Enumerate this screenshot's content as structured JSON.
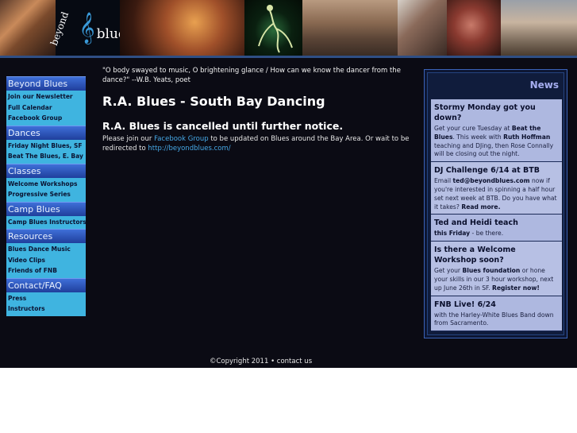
{
  "header": {
    "logo_line1": "beyond",
    "logo_line2": "blues",
    "photos": [
      "couple-photo",
      "logo",
      "guitarist-photo",
      "dancer-silhouette-photo",
      "dance-hall-photo",
      "swing-couple-photo",
      "embrace-photo",
      "group-photo"
    ],
    "colors": {
      "banner_rule": "#2f4f85",
      "clef": "#3a9ad8"
    }
  },
  "nav": [
    {
      "title": "Beyond Blues",
      "items": [
        "Join our Newsletter",
        "Full Calendar",
        "Facebook Group"
      ]
    },
    {
      "title": "Dances",
      "items": [
        "Friday Night Blues, SF",
        "Beat The Blues, E. Bay"
      ]
    },
    {
      "title": "Classes",
      "items": [
        "Welcome Workshops",
        "Progressive Series"
      ]
    },
    {
      "title": "Camp Blues",
      "items": [
        "Camp Blues Instructors"
      ]
    },
    {
      "title": "Resources",
      "items": [
        "Blues Dance Music",
        "Video Clips",
        "Friends of FNB"
      ]
    },
    {
      "title": "Contact/FAQ",
      "items": [
        "Press",
        "Instructors"
      ]
    }
  ],
  "main": {
    "quote": "\"O body swayed to music, O brightening glance / How can we know the dancer from the dance?\" --W.B. Yeats, poet",
    "title": "R.A. Blues - South Bay Dancing",
    "notice": "R.A. Blues is cancelled until further notice.",
    "message_before": "Please join our ",
    "facebook_link": "Facebook Group",
    "message_middle": " to be updated on Blues around the Bay Area. Or wait to be redirected to ",
    "redirect_link": "http://beyondblues.com/"
  },
  "news": {
    "title": "News",
    "items": [
      {
        "heading": "Stormy Monday got you down?",
        "parts": [
          {
            "t": "Get your cure Tuesday at ",
            "b": false
          },
          {
            "t": "Beat the Blues",
            "b": true
          },
          {
            "t": ". This week with ",
            "b": false
          },
          {
            "t": "Ruth Hoffman",
            "b": true
          },
          {
            "t": " teaching and DJing, then Rose Connally will be closing out the night.",
            "b": false
          }
        ]
      },
      {
        "heading": "DJ Challenge 6/14 at BTB",
        "parts": [
          {
            "t": "Email ",
            "b": false
          },
          {
            "t": "ted@beyondblues.com",
            "b": true
          },
          {
            "t": " now if you're interested in spinning a half hour set next week at BTB. Do you have what it takes? ",
            "b": false
          },
          {
            "t": "Read more.",
            "b": true
          }
        ]
      },
      {
        "heading": "Ted and Heidi teach",
        "parts": [
          {
            "t": "this Friday",
            "b": true
          },
          {
            "t": " - be there.",
            "b": false
          }
        ]
      },
      {
        "heading": "Is there a Welcome Workshop soon?",
        "parts": [
          {
            "t": "Get your ",
            "b": false
          },
          {
            "t": "Blues foundation",
            "b": true
          },
          {
            "t": " or hone your skills in our 3 hour workshop, next up June 26th in SF. ",
            "b": false
          },
          {
            "t": "Register now!",
            "b": true
          }
        ]
      },
      {
        "heading": "FNB Live! 6/24",
        "parts": [
          {
            "t": "with the Harley-White Blues Band down from Sacramento.",
            "b": false
          }
        ]
      }
    ]
  },
  "footer": {
    "copyright": "©Copyright 2011",
    "separator": " • ",
    "contact": "contact us"
  }
}
